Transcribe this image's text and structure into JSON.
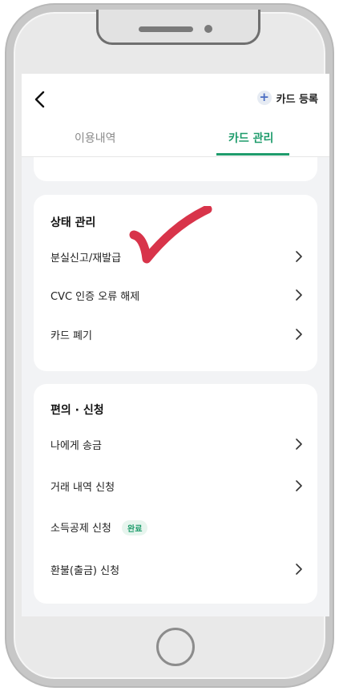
{
  "header": {
    "register_label": "카드 등록",
    "register_icon": "plus-circle-icon",
    "back_icon": "chevron-left-icon"
  },
  "tabs": [
    {
      "label": "이용내역",
      "active": false
    },
    {
      "label": "카드 관리",
      "active": true
    }
  ],
  "accent_color": "#1f9c6c",
  "status_section": {
    "title": "상태 관리",
    "items": [
      {
        "label": "분실신고/재발급"
      },
      {
        "label": "CVC 인증 오류 해제"
      },
      {
        "label": "카드 폐기"
      }
    ]
  },
  "service_section": {
    "title": "편의 · 신청",
    "items": [
      {
        "label": "나에게 송금"
      },
      {
        "label": "거래 내역 신청"
      },
      {
        "label": "소득공제 신청",
        "badge": "완료"
      },
      {
        "label": "환불(출금) 신청"
      }
    ]
  },
  "annotation": {
    "mark": "checkmark",
    "color": "#d8344a"
  }
}
